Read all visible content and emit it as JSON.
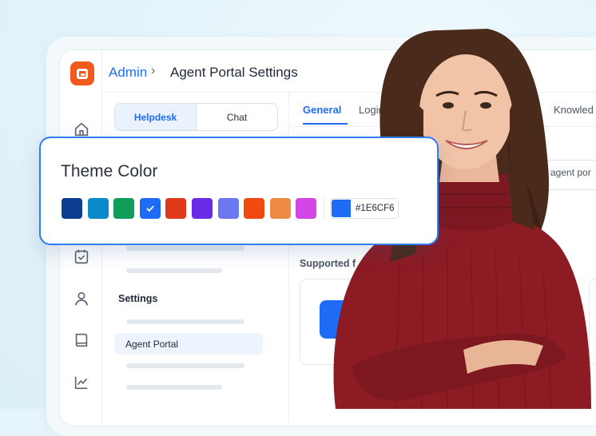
{
  "breadcrumb": {
    "root": "Admin",
    "separator": "›",
    "current": "Agent Portal Settings"
  },
  "segmented": {
    "left": "Helpdesk",
    "right": "Chat"
  },
  "tabs": [
    "General",
    "Login",
    "Knowled"
  ],
  "sidebar": {
    "section_title": "Settings",
    "active_item": "Agent Portal"
  },
  "content": {
    "field_text": "agent por",
    "supported_label": "Supported f"
  },
  "theme_color": {
    "title": "Theme Color",
    "swatches": [
      "#0b3d91",
      "#0a8ac9",
      "#0f9d58",
      "#1e6cf6",
      "#e0391a",
      "#6a2be6",
      "#6c78f0",
      "#f04a0f",
      "#ef8a45",
      "#d346e6"
    ],
    "selected_index": 3,
    "hex_value": "#1E6CF6"
  },
  "icons": [
    "home-icon",
    "calendar-check-icon",
    "user-icon",
    "book-icon",
    "chart-line-icon",
    "check-icon"
  ]
}
